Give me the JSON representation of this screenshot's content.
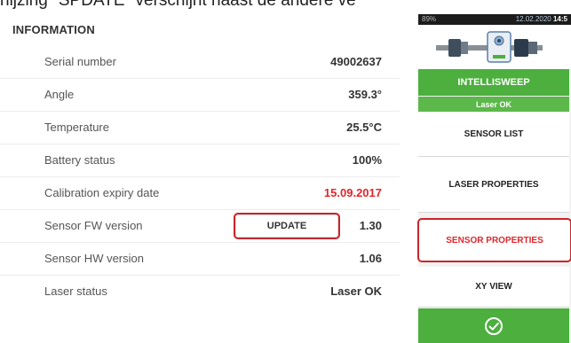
{
  "caption": "nijzing \"SPDATE\" verschijnt naast de andere ve",
  "info": {
    "title": "INFORMATION",
    "rows": [
      {
        "label": "Serial number",
        "value": "49002637"
      },
      {
        "label": "Angle",
        "value": "359.3°"
      },
      {
        "label": "Temperature",
        "value": "25.5°C"
      },
      {
        "label": "Battery status",
        "value": "100%"
      },
      {
        "label": "Calibration expiry date",
        "value": "15.09.2017"
      },
      {
        "label": "Sensor FW version",
        "value": "1.30"
      },
      {
        "label": "Sensor HW version",
        "value": "1.06"
      },
      {
        "label": "Laser status",
        "value": "Laser OK"
      }
    ],
    "update_label": "UPDATE"
  },
  "device": {
    "battery": "89%",
    "date": "12.02.2020",
    "time": "14:5",
    "sensor_image": "sensor-device",
    "intellisweep": "INTELLISWEEP",
    "laser_status": "Laser OK",
    "menu": {
      "sensor_list": "SENSOR LIST",
      "laser_properties": "LASER PROPERTIES",
      "sensor_properties": "SENSOR PROPERTIES",
      "xy_view": "XY VIEW"
    },
    "confirm_icon": "check-circle-icon"
  },
  "colors": {
    "green": "#4caf3e",
    "red": "#e2252b"
  }
}
